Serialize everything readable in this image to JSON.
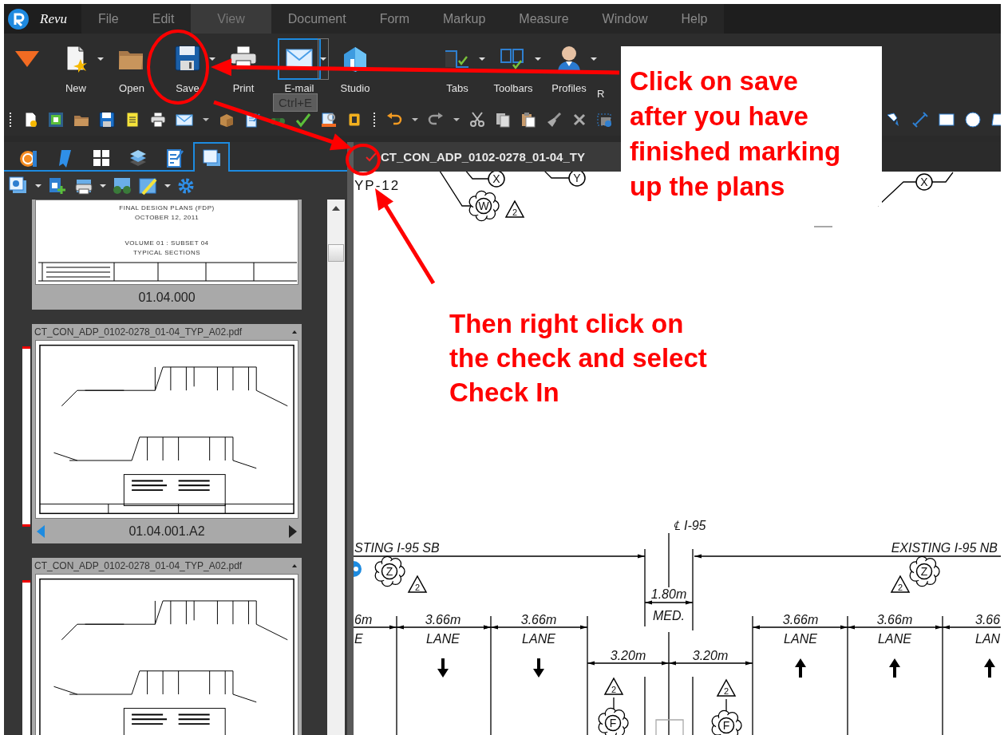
{
  "menu_bar": {
    "app_name": "Revu",
    "menus": [
      {
        "label": "File",
        "selected": false
      },
      {
        "label": "Edit",
        "selected": false
      },
      {
        "label": "View",
        "selected": true
      },
      {
        "label": "Document",
        "selected": false
      },
      {
        "label": "Form",
        "selected": false
      },
      {
        "label": "Markup",
        "selected": false
      },
      {
        "label": "Measure",
        "selected": false
      },
      {
        "label": "Window",
        "selected": false
      },
      {
        "label": "Help",
        "selected": false
      }
    ]
  },
  "ribbon": {
    "buttons": [
      {
        "label": "New",
        "dropdown": true,
        "hovered": false
      },
      {
        "label": "Open",
        "dropdown": false,
        "hovered": false
      },
      {
        "label": "Save",
        "dropdown": true,
        "hovered": false
      },
      {
        "label": "Print",
        "dropdown": false,
        "hovered": false
      },
      {
        "label": "E-mail",
        "dropdown": true,
        "hovered": true
      },
      {
        "label": "Studio",
        "dropdown": false,
        "hovered": false
      },
      {
        "label": "Tabs",
        "dropdown": true,
        "hovered": false
      },
      {
        "label": "Toolbars",
        "dropdown": true,
        "hovered": false
      },
      {
        "label": "Profiles",
        "dropdown": true,
        "hovered": false
      },
      {
        "label": "R",
        "dropdown": false,
        "hovered": false
      }
    ],
    "tooltip": "Ctrl+E"
  },
  "side_panel": {
    "tabs": [
      {
        "selected": false
      },
      {
        "selected": false
      },
      {
        "selected": false
      },
      {
        "selected": false
      },
      {
        "selected": false
      },
      {
        "selected": true
      }
    ],
    "thumbnails": [
      {
        "page_lines": [
          "FINAL DESIGN PLANS (FDP)",
          "OCTOBER 12, 2011",
          "VOLUME 01 : SUBSET 04",
          "TYPICAL SECTIONS"
        ],
        "page_label": "01.04.000"
      },
      {
        "file_name": "CT_CON_ADP_0102-0278_01-04_TYP_A02.pdf",
        "page_label": "01.04.001.A2"
      },
      {
        "file_name": "CT_CON_ADP_0102-0278_01-04_TYP_A02.pdf"
      }
    ]
  },
  "document": {
    "tab_title": "CT_CON_ADP_0102-0278_01-04_TY",
    "checked_out": true,
    "drawing_labels": [
      "YP-12",
      "℄ I-95",
      "STING I-95 SB",
      "EXISTING I-95 NB",
      "1.80m",
      "MED.",
      "6m",
      "E",
      "3.66m",
      "LANE",
      "3.66m",
      "LANE",
      "3.20m",
      "3.20m",
      "3.66m",
      "LANE",
      "3.66m",
      "LANE",
      "3.66",
      "LAN"
    ],
    "tags": [
      {
        "letter": "X",
        "kind": "circle"
      },
      {
        "letter": "Y",
        "kind": "circle"
      },
      {
        "letter": "X",
        "kind": "circle"
      },
      {
        "letter": "W",
        "kind": "cloud"
      },
      {
        "letter": "2",
        "kind": "triangle"
      },
      {
        "letter": "Z",
        "kind": "cloud"
      },
      {
        "letter": "2",
        "kind": "triangle"
      },
      {
        "letter": "Z",
        "kind": "cloud"
      },
      {
        "letter": "2",
        "kind": "triangle"
      },
      {
        "letter": "2",
        "kind": "triangle"
      },
      {
        "letter": "F",
        "kind": "cloud"
      },
      {
        "letter": "2",
        "kind": "triangle"
      },
      {
        "letter": "F",
        "kind": "cloud"
      }
    ]
  },
  "annotations": {
    "callouts": [
      {
        "text": "Click on save\nafter you have\nfinished marking\nup the plans",
        "boxed": true
      },
      {
        "text": "Then right click on\nthe check and select\nCheck In",
        "boxed": false
      }
    ]
  }
}
